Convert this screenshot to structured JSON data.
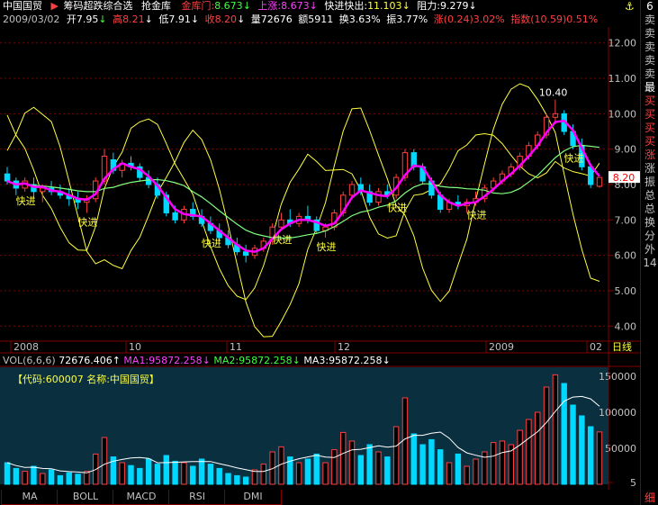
{
  "header": {
    "stock_name": "中国国贸",
    "formula": "筹码超跌综合选",
    "formula2": "抢金库",
    "jinkumen_label": "金库门:",
    "jinkumen_value": "8.673",
    "shangzhang_label": "上涨:",
    "shangzhang_value": "8.673",
    "kuaijin_label": "快进快出:",
    "kuaijin_value": "11.103",
    "zuli_label": "阻力:",
    "zuli_value": "9.279"
  },
  "info": {
    "date": "2009/03/02",
    "open_label": "开",
    "open": "7.95",
    "high_label": "高",
    "high": "8.21",
    "low_label": "低",
    "low": "7.91",
    "close_label": "收",
    "close": "8.20",
    "volume_label": "量",
    "volume": "72676",
    "amount_label": "额",
    "amount": "5911",
    "turnover_label": "换",
    "turnover": "3.63%",
    "amplitude_label": "振",
    "amplitude": "3.77%",
    "change_label": "涨",
    "change": "(0.24)3.02%",
    "index_label": "指数",
    "index": "(10.59)0.51%"
  },
  "volume_header": {
    "label": "VOL(6,6,6)",
    "vol": "72676.406",
    "ma1_label": "MA1:",
    "ma1": "95872.258",
    "ma2_label": "MA2:",
    "ma2": "95872.258",
    "ma3_label": "MA3:",
    "ma3": "95872.258"
  },
  "volume_note": "【代码:600007 名称:中国国贸】",
  "x_axis": {
    "labels": [
      "2008",
      "10",
      "11",
      "12",
      "2009",
      "02"
    ],
    "right_label": "日线"
  },
  "current_price_tag": "8.20",
  "peak_label": "10.40",
  "kuaijin_text": "快进",
  "tabs": [
    "MA",
    "BOLL",
    "MACD",
    "RSI",
    "DMI"
  ],
  "right_panel": [
    "卖",
    "卖",
    "卖",
    "卖",
    "卖",
    "最",
    "买",
    "买",
    "买",
    "买",
    "涨",
    "涨",
    "振",
    "总",
    "总",
    "换",
    "分",
    "外",
    "",
    "14"
  ],
  "right_panel_top": "6",
  "right_panel_bottom": "细",
  "colors": {
    "up": "#ff4040",
    "down": "#00d8ff",
    "ma_magenta": "#ff00ff",
    "ma_green": "#80ff80",
    "yellow": "#ffff40",
    "axis": "#800000"
  },
  "chart_data": [
    {
      "type": "candlestick",
      "y_axis_ticks": [
        4.0,
        5.0,
        6.0,
        7.0,
        8.0,
        9.0,
        10.0,
        11.0,
        12.0
      ],
      "ylim": [
        3.6,
        12.4
      ],
      "candles": [
        [
          8.3,
          8.5,
          8.0,
          8.1
        ],
        [
          8.1,
          8.2,
          7.7,
          7.9
        ],
        [
          7.9,
          8.2,
          7.8,
          8.1
        ],
        [
          8.0,
          8.2,
          7.6,
          7.8
        ],
        [
          7.8,
          8.0,
          7.5,
          7.9
        ],
        [
          7.9,
          8.1,
          7.7,
          7.8
        ],
        [
          7.8,
          8.0,
          7.6,
          7.7
        ],
        [
          7.7,
          7.9,
          7.4,
          7.6
        ],
        [
          7.6,
          7.8,
          7.3,
          7.5
        ],
        [
          7.5,
          7.7,
          7.2,
          7.6
        ],
        [
          7.6,
          8.2,
          7.5,
          8.1
        ],
        [
          8.1,
          9.0,
          8.0,
          8.8
        ],
        [
          8.7,
          8.9,
          8.3,
          8.4
        ],
        [
          8.4,
          8.7,
          8.2,
          8.6
        ],
        [
          8.6,
          8.8,
          8.4,
          8.5
        ],
        [
          8.5,
          8.6,
          8.1,
          8.2
        ],
        [
          8.2,
          8.4,
          7.9,
          8.0
        ],
        [
          8.0,
          8.2,
          7.6,
          7.7
        ],
        [
          7.7,
          7.8,
          7.1,
          7.2
        ],
        [
          7.2,
          7.4,
          6.9,
          7.0
        ],
        [
          7.0,
          7.4,
          6.9,
          7.3
        ],
        [
          7.3,
          7.5,
          7.0,
          7.1
        ],
        [
          7.1,
          7.3,
          6.8,
          6.9
        ],
        [
          6.9,
          7.1,
          6.6,
          6.7
        ],
        [
          6.7,
          6.9,
          6.4,
          6.5
        ],
        [
          6.5,
          6.7,
          6.2,
          6.3
        ],
        [
          6.3,
          6.5,
          6.0,
          6.1
        ],
        [
          6.1,
          6.3,
          5.8,
          6.0
        ],
        [
          6.0,
          6.3,
          5.9,
          6.2
        ],
        [
          6.2,
          6.5,
          6.1,
          6.4
        ],
        [
          6.4,
          6.9,
          6.3,
          6.8
        ],
        [
          6.8,
          7.2,
          6.7,
          7.0
        ],
        [
          7.0,
          7.3,
          6.8,
          6.9
        ],
        [
          6.9,
          7.2,
          6.8,
          7.1
        ],
        [
          7.1,
          7.4,
          6.9,
          7.0
        ],
        [
          7.0,
          7.1,
          6.6,
          6.7
        ],
        [
          6.7,
          6.9,
          6.5,
          6.8
        ],
        [
          6.8,
          7.3,
          6.7,
          7.2
        ],
        [
          7.2,
          7.8,
          7.1,
          7.7
        ],
        [
          7.7,
          8.1,
          7.6,
          8.0
        ],
        [
          8.0,
          8.2,
          7.7,
          7.8
        ],
        [
          7.8,
          8.0,
          7.4,
          7.5
        ],
        [
          7.5,
          7.9,
          7.4,
          7.8
        ],
        [
          7.8,
          8.0,
          7.6,
          7.7
        ],
        [
          7.7,
          8.3,
          7.6,
          8.2
        ],
        [
          8.2,
          9.0,
          8.1,
          8.9
        ],
        [
          8.9,
          9.0,
          8.4,
          8.5
        ],
        [
          8.5,
          8.6,
          8.0,
          8.1
        ],
        [
          8.1,
          8.2,
          7.6,
          7.7
        ],
        [
          7.7,
          7.8,
          7.2,
          7.3
        ],
        [
          7.3,
          7.6,
          7.2,
          7.5
        ],
        [
          7.5,
          7.7,
          7.3,
          7.4
        ],
        [
          7.4,
          7.6,
          7.2,
          7.5
        ],
        [
          7.5,
          7.8,
          7.4,
          7.6
        ],
        [
          7.6,
          8.0,
          7.5,
          7.9
        ],
        [
          7.9,
          8.2,
          7.8,
          8.1
        ],
        [
          8.1,
          8.4,
          8.0,
          8.3
        ],
        [
          8.3,
          8.6,
          8.2,
          8.5
        ],
        [
          8.5,
          8.9,
          8.4,
          8.8
        ],
        [
          8.8,
          9.2,
          8.7,
          9.1
        ],
        [
          9.1,
          9.5,
          9.0,
          9.4
        ],
        [
          9.4,
          10.0,
          9.3,
          9.9
        ],
        [
          9.9,
          10.4,
          9.7,
          10.0
        ],
        [
          10.0,
          10.1,
          9.4,
          9.5
        ],
        [
          9.5,
          9.7,
          9.0,
          9.1
        ],
        [
          9.1,
          9.3,
          8.4,
          8.5
        ],
        [
          8.5,
          8.6,
          7.9,
          8.0
        ],
        [
          7.95,
          8.21,
          7.91,
          8.2
        ]
      ],
      "volumes": [
        30000,
        22000,
        18000,
        25000,
        15000,
        20000,
        12000,
        16000,
        14000,
        18000,
        42000,
        65000,
        38000,
        30000,
        26000,
        22000,
        35000,
        28000,
        40000,
        32000,
        30000,
        25000,
        35000,
        28000,
        22000,
        15000,
        12000,
        10000,
        20000,
        28000,
        45000,
        52000,
        38000,
        30000,
        35000,
        42000,
        30000,
        48000,
        72000,
        60000,
        40000,
        55000,
        45000,
        38000,
        80000,
        120000,
        70000,
        55000,
        62000,
        48000,
        30000,
        42000,
        25000,
        35000,
        45000,
        58000,
        60000,
        55000,
        75000,
        90000,
        100000,
        135000,
        152000,
        140000,
        110000,
        95000,
        80000,
        72676
      ]
    }
  ]
}
